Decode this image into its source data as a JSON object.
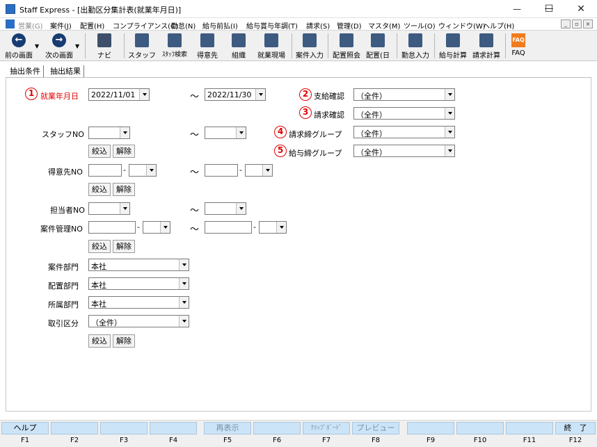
{
  "window": {
    "title": "Staff Express - [出勤区分集計表(就業年月日)]",
    "minimize": "—",
    "maximize": "☐",
    "close": "✕"
  },
  "menu": {
    "items": [
      "営業(G)",
      "案件(J)",
      "配置(H)",
      "コンプライアンス(C)",
      "勤怠(N)",
      "給与前払(I)",
      "給与賞与年調(T)",
      "請求(S)",
      "管理(D)",
      "マスタ(M)",
      "ツール(O)",
      "ウィンドウ(W)",
      "ヘルプ(H)"
    ],
    "mdi_min": "_",
    "mdi_restore": "▫",
    "mdi_close": "×"
  },
  "toolbar": {
    "back": "前の画面",
    "next": "次の画面",
    "navi": "ナビ",
    "staff": "スタッフ",
    "staff_search": "ｽﾀｯﾌ検索",
    "customer": "得意先",
    "org": "組織",
    "site": "就業現場",
    "case_entry": "案件入力",
    "assign_ref": "配置照会",
    "assign_day": "配置(日",
    "attendance": "勤怠入力",
    "pay_calc": "給与計算",
    "bill_calc": "請求計算",
    "faq": "FAQ",
    "faq_icon_text": "FAQ"
  },
  "tabs": [
    "抽出条件",
    "抽出結果"
  ],
  "form": {
    "badge1": "1",
    "badge2": "2",
    "badge3": "3",
    "badge4": "4",
    "badge5": "5",
    "work_date_label": "就業年月日",
    "date_from": "2022/11/01",
    "date_to": "2022/11/30",
    "tilde": "～",
    "dash": "-",
    "pay_confirm_label": "支給確認",
    "pay_confirm_value": "（全件）",
    "bill_confirm_label": "請求確認",
    "bill_confirm_value": "（全件）",
    "bill_group_label": "請求締グループ",
    "bill_group_value": "（全件）",
    "pay_group_label": "給与締グループ",
    "pay_group_value": "（全件）",
    "staff_no_label": "スタッフNO",
    "customer_no_label": "得意先NO",
    "person_no_label": "担当者NO",
    "case_no_label": "案件管理NO",
    "case_dept_label": "案件部門",
    "case_dept_value": "本社",
    "assign_dept_label": "配置部門",
    "assign_dept_value": "本社",
    "belong_dept_label": "所属部門",
    "belong_dept_value": "本社",
    "trade_type_label": "取引区分",
    "trade_type_value": "（全件）",
    "filter_btn": "絞込",
    "clear_btn": "解除"
  },
  "fkeys": {
    "labels": [
      "ヘルプ",
      "",
      "",
      "",
      "再表示",
      "",
      "ｸﾘｯﾌﾟﾎﾞｰﾄﾞ",
      "プレビュー",
      "",
      "",
      "",
      "終　了"
    ],
    "keys": [
      "F1",
      "F2",
      "F3",
      "F4",
      "F5",
      "F6",
      "F7",
      "F8",
      "F9",
      "F10",
      "F11",
      "F12"
    ]
  }
}
